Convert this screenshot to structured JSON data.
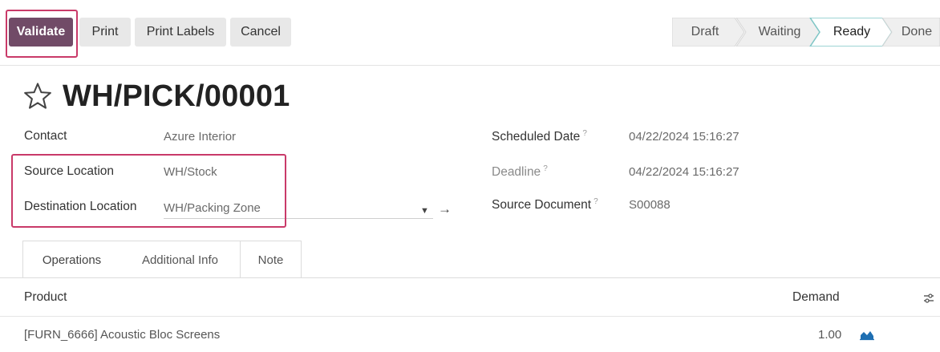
{
  "toolbar": {
    "validate": "Validate",
    "print": "Print",
    "print_labels": "Print Labels",
    "cancel": "Cancel"
  },
  "status": {
    "stages": [
      "Draft",
      "Waiting",
      "Ready",
      "Done"
    ],
    "current": "Ready"
  },
  "record": {
    "title": "WH/PICK/00001",
    "favorite": false
  },
  "fields": {
    "contact_label": "Contact",
    "contact_value": "Azure Interior",
    "source_location_label": "Source Location",
    "source_location_value": "WH/Stock",
    "destination_location_label": "Destination Location",
    "destination_location_value": "WH/Packing Zone",
    "scheduled_date_label": "Scheduled Date",
    "scheduled_date_value": "04/22/2024 15:16:27",
    "deadline_label": "Deadline",
    "deadline_value": "04/22/2024 15:16:27",
    "source_document_label": "Source Document",
    "source_document_value": "S00088",
    "help_mark": "?"
  },
  "tabs": [
    "Operations",
    "Additional Info",
    "Note"
  ],
  "table": {
    "headers": {
      "product": "Product",
      "demand": "Demand"
    },
    "rows": [
      {
        "product": "[FURN_6666] Acoustic Bloc Screens",
        "demand": "1.00"
      }
    ]
  },
  "colors": {
    "primary": "#714b67",
    "highlight": "#c93a69",
    "active_stage": "#ffffff",
    "stage_border": "#7fc6c6"
  }
}
